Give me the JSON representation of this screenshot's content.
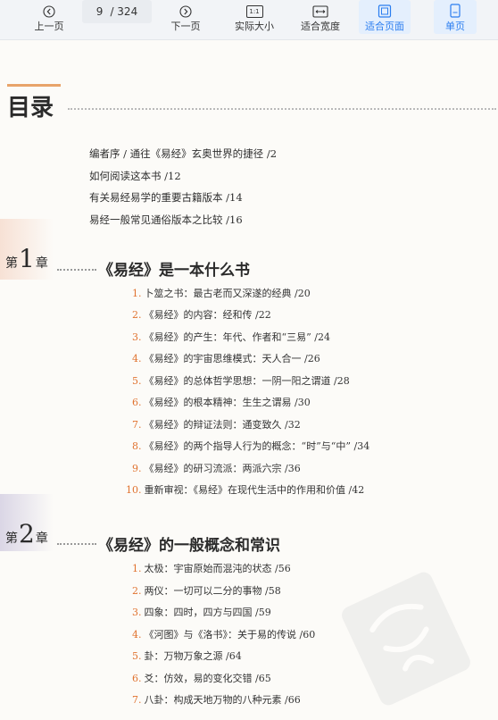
{
  "toolbar": {
    "prev": "上一页",
    "page_current": "9",
    "page_total": "/ 324",
    "next": "下一页",
    "actual_size": "实际大小",
    "actual_size_icon_text": "1:1",
    "fit_width": "适合宽度",
    "fit_page": "适合页面",
    "single_page": "单页",
    "accent_color": "#2a7df0"
  },
  "toc": {
    "title": "目录",
    "preface": [
      "编者序 / 通往《易经》玄奥世界的捷径 /2",
      "如何阅读这本书 /12",
      "有关易经易学的重要古籍版本 /14",
      "易经一般常见通俗版本之比较 /16"
    ],
    "chapters": [
      {
        "prefix": "第",
        "num": "1",
        "suffix": "章",
        "title": "《易经》是一本什么书",
        "items": [
          {
            "n": "1.",
            "text": "卜筮之书：最古老而又深遂的经典 /20"
          },
          {
            "n": "2.",
            "text": "《易经》的内容：经和传 /22"
          },
          {
            "n": "3.",
            "text": "《易经》的产生：年代、作者和“三易” /24"
          },
          {
            "n": "4.",
            "text": "《易经》的宇宙思维模式：天人合一 /26"
          },
          {
            "n": "5.",
            "text": "《易经》的总体哲学思想：一阴一阳之谓道 /28"
          },
          {
            "n": "6.",
            "text": "《易经》的根本精神：生生之谓易 /30"
          },
          {
            "n": "7.",
            "text": "《易经》的辩证法则：通变致久 /32"
          },
          {
            "n": "8.",
            "text": "《易经》的两个指导人行为的概念：“时”与“中” /34"
          },
          {
            "n": "9.",
            "text": "《易经》的研习流派：两派六宗 /36"
          },
          {
            "n": "10.",
            "text": "重新审视：《易经》在现代生活中的作用和价值 /42"
          }
        ]
      },
      {
        "prefix": "第",
        "num": "2",
        "suffix": "章",
        "title": "《易经》的一般概念和常识",
        "items": [
          {
            "n": "1.",
            "text": "太极：宇宙原始而混沌的状态 /56"
          },
          {
            "n": "2.",
            "text": "两仪：一切可以二分的事物 /58"
          },
          {
            "n": "3.",
            "text": "四象：四时，四方与四国 /59"
          },
          {
            "n": "4.",
            "text": "《河图》与《洛书》：关于易的传说 /60"
          },
          {
            "n": "5.",
            "text": "卦：万物万象之源 /64"
          },
          {
            "n": "6.",
            "text": "爻：仿效，易的变化交错 /65"
          },
          {
            "n": "7.",
            "text": "八卦：构成天地万物的八种元素 /66"
          }
        ]
      }
    ]
  }
}
